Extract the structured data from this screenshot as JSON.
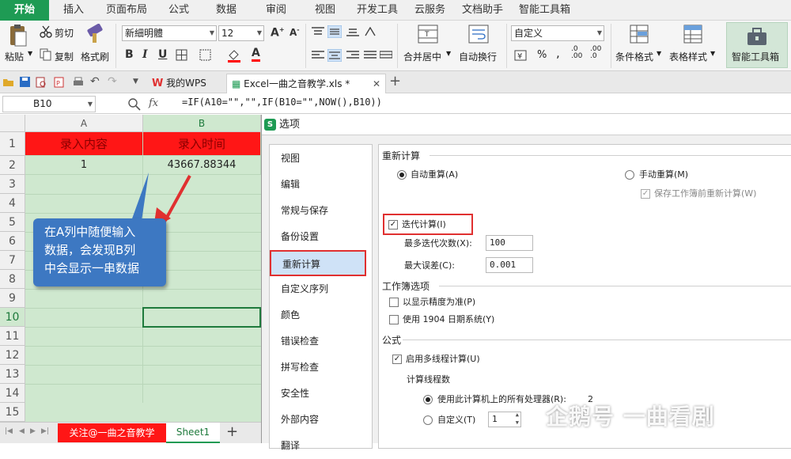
{
  "menu": {
    "tabs": [
      "开始",
      "插入",
      "页面布局",
      "公式",
      "数据",
      "审阅",
      "视图",
      "开发工具",
      "云服务",
      "文档助手",
      "智能工具箱"
    ]
  },
  "ribbon": {
    "paste": "粘贴",
    "cut": "剪切",
    "copy": "复制",
    "format_painter": "格式刷",
    "font_name": "新細明體",
    "font_size": "12",
    "bold": "B",
    "italic": "I",
    "underline": "U",
    "merge_center": "合并居中",
    "wrap_text": "自动换行",
    "number_format": "自定义",
    "percent": "%",
    "comma": ",",
    "cond_format": "条件格式",
    "table_style": "表格样式",
    "smart_toolbox": "智能工具箱"
  },
  "tabs": {
    "wps": "我的WPS",
    "doc": "Excel一曲之音教学.xls *"
  },
  "formula_bar": {
    "name_box": "B10",
    "fx": "fx",
    "formula": "=IF(A10=\"\",\"\",IF(B10=\"\",NOW(),B10))"
  },
  "sheet": {
    "columns": [
      "A",
      "B"
    ],
    "rows": [
      "1",
      "2",
      "3",
      "4",
      "5",
      "6",
      "7",
      "8",
      "9",
      "10",
      "11",
      "12",
      "13",
      "14",
      "15"
    ],
    "header_a": "录入内容",
    "header_b": "录入时间",
    "a2": "1",
    "b2": "43667.88344",
    "callout": [
      "在A列中随便输入",
      "数据，会发现B列",
      "中会显示一串数据"
    ],
    "tab_follow": "关注@一曲之音教学",
    "tab_sheet": "Sheet1",
    "add": "+"
  },
  "dialog": {
    "title": "选项",
    "nav": [
      "视图",
      "编辑",
      "常规与保存",
      "备份设置",
      "重新计算",
      "自定义序列",
      "颜色",
      "错误检查",
      "拼写检查",
      "安全性",
      "外部内容",
      "翻译"
    ],
    "recalc_title": "重新计算",
    "auto_calc": "自动重算(A)",
    "manual_calc": "手动重算(M)",
    "save_recalc": "保存工作簿前重新计算(W)",
    "iterative": "迭代计算(I)",
    "max_iter_label": "最多迭代次数(X):",
    "max_iter_value": "100",
    "max_change_label": "最大误差(C):",
    "max_change_value": "0.001",
    "workbook_title": "工作簿选项",
    "precision": "以显示精度为准(P)",
    "date1904": "使用 1904 日期系统(Y)",
    "formula_title": "公式",
    "multithread": "启用多线程计算(U)",
    "threads_title": "计算线程数",
    "use_all": "使用此计算机上的所有处理器(R):",
    "use_all_value": "2",
    "custom": "自定义(T)",
    "custom_value": "1"
  },
  "watermark": "企鹅号 一曲看剧",
  "colors": {
    "accent": "#1e9b54",
    "header_red": "#ff1616",
    "callout_blue": "#3d78c2",
    "highlight_red": "#e03030"
  }
}
